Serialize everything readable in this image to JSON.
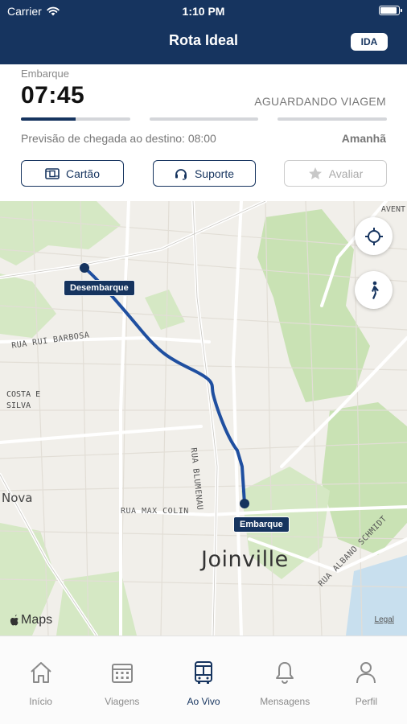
{
  "status_bar": {
    "carrier": "Carrier",
    "time": "1:10 PM"
  },
  "header": {
    "title": "Rota Ideal",
    "direction_badge": "IDA"
  },
  "trip": {
    "embarque_label": "Embarque",
    "embarque_time": "07:45",
    "status": "AGUARDANDO VIAGEM",
    "progress_segments": [
      0.5,
      0,
      0
    ],
    "arrival_forecast": "Previsão de chegada ao destino: 08:00",
    "day": "Amanhã"
  },
  "actions": {
    "cartao": "Cartão",
    "suporte": "Suporte",
    "avaliar": "Avaliar"
  },
  "map": {
    "pin_desembarque": "Desembarque",
    "pin_embarque": "Embarque",
    "city": "Joinville",
    "place_nova": "Nova",
    "place_costa_1": "COSTA E",
    "place_costa_2": "SILVA",
    "place_avent": "AVENT",
    "street_rui_barbosa": "RUA RUI BARBOSA",
    "street_max_colin": "RUA MAX COLIN",
    "street_blumenau": "RUA BLUMENAU",
    "street_albano_schmidt": "RUA ALBANO SCHMIDT",
    "attribution": "Maps",
    "legal": "Legal",
    "route_color": "#1f4fa0"
  },
  "tabbar": {
    "items": [
      {
        "label": "Início",
        "icon": "home-icon"
      },
      {
        "label": "Viagens",
        "icon": "calendar-icon"
      },
      {
        "label": "Ao Vivo",
        "icon": "bus-icon",
        "active": true
      },
      {
        "label": "Mensagens",
        "icon": "bell-icon"
      },
      {
        "label": "Perfil",
        "icon": "person-icon"
      }
    ]
  },
  "colors": {
    "brand": "#16345f",
    "route": "#1f4fa0"
  }
}
